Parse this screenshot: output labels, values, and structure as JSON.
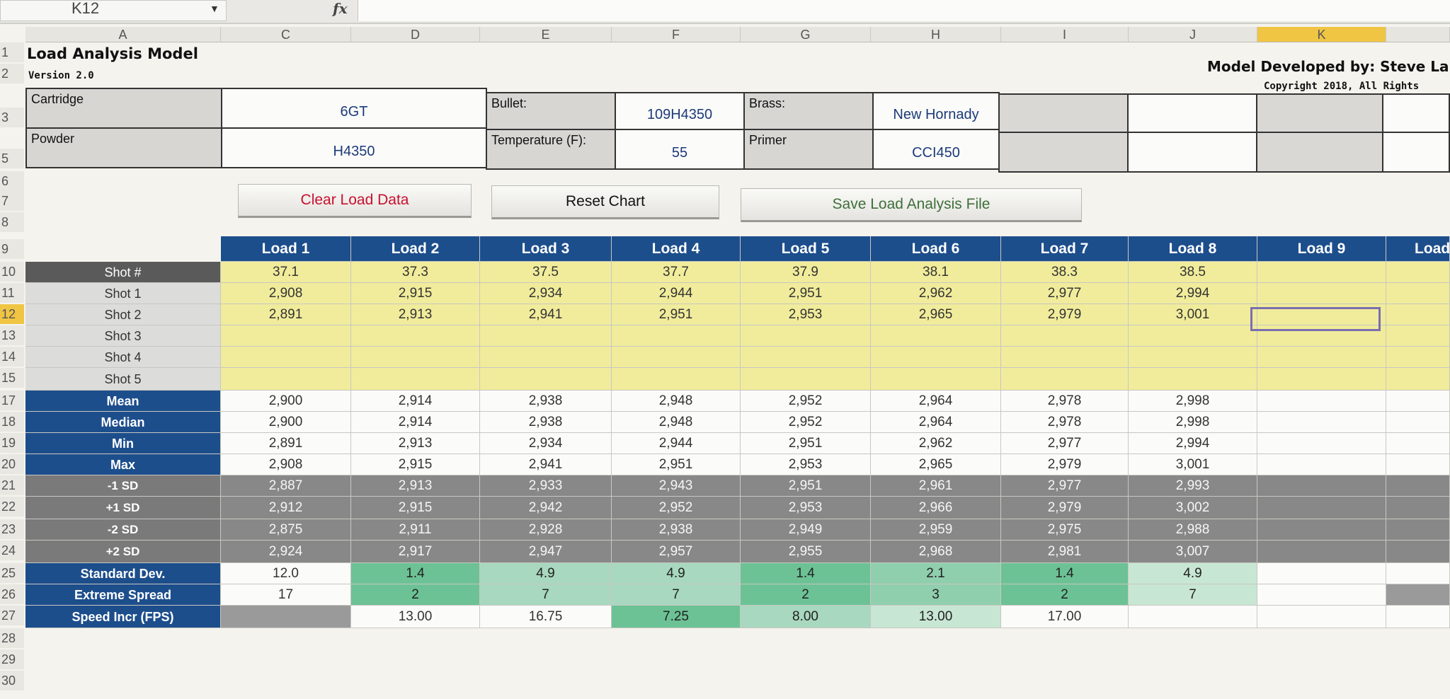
{
  "formula_bar": {
    "name_box": "K12",
    "fx": "fx"
  },
  "columns": [
    "A",
    "C",
    "D",
    "E",
    "F",
    "G",
    "H",
    "I",
    "J",
    "K"
  ],
  "rows": [
    "1",
    "2",
    "3",
    "5",
    "6",
    "7",
    "8",
    "9",
    "10",
    "11",
    "12",
    "13",
    "14",
    "15",
    "17",
    "18",
    "19",
    "20",
    "21",
    "22",
    "23",
    "24",
    "25",
    "26",
    "27",
    "28",
    "29",
    "30"
  ],
  "header": {
    "title": "Load Analysis Model",
    "version": "Version 2.0",
    "developer": "Model Developed by: Steve La",
    "copyright": "Copyright 2018, All Rights"
  },
  "info": {
    "cartridge_label": "Cartridge",
    "cartridge": "6GT",
    "bullet_label": "Bullet:",
    "bullet": "109H4350",
    "brass_label": "Brass:",
    "brass": "New Hornady",
    "powder_label": "Powder",
    "powder": "H4350",
    "temp_label": "Temperature (F):",
    "temp": "55",
    "primer_label": "Primer",
    "primer": "CCI450"
  },
  "buttons": {
    "clear": "Clear Load Data",
    "reset": "Reset Chart",
    "save": "Save Load Analysis File"
  },
  "colors": {
    "clear_button_text": "#c8102e",
    "save_button_text": "#3f6f3a",
    "load_header": "#1d4e8c",
    "input_yellow": "#f1ec9b"
  },
  "loads": [
    "Load 1",
    "Load 2",
    "Load 3",
    "Load 4",
    "Load 5",
    "Load 6",
    "Load 7",
    "Load 8",
    "Load 9",
    "Load"
  ],
  "row_labels": {
    "shot_num": "Shot #",
    "shots": [
      "Shot 1",
      "Shot 2",
      "Shot 3",
      "Shot 4",
      "Shot 5"
    ],
    "stats": [
      "Mean",
      "Median",
      "Min",
      "Max"
    ],
    "sd": [
      "-1 SD",
      "+1 SD",
      "-2 SD",
      "+2 SD"
    ],
    "summary": [
      "Standard Dev.",
      "Extreme Spread",
      "Speed Incr (FPS)"
    ]
  },
  "table": {
    "charge": [
      "37.1",
      "37.3",
      "37.5",
      "37.7",
      "37.9",
      "38.1",
      "38.3",
      "38.5"
    ],
    "shot1": [
      "2,908",
      "2,915",
      "2,934",
      "2,944",
      "2,951",
      "2,962",
      "2,977",
      "2,994"
    ],
    "shot2": [
      "2,891",
      "2,913",
      "2,941",
      "2,951",
      "2,953",
      "2,965",
      "2,979",
      "3,001"
    ],
    "mean": [
      "2,900",
      "2,914",
      "2,938",
      "2,948",
      "2,952",
      "2,964",
      "2,978",
      "2,998"
    ],
    "median": [
      "2,900",
      "2,914",
      "2,938",
      "2,948",
      "2,952",
      "2,964",
      "2,978",
      "2,998"
    ],
    "min": [
      "2,891",
      "2,913",
      "2,934",
      "2,944",
      "2,951",
      "2,962",
      "2,977",
      "2,994"
    ],
    "max": [
      "2,908",
      "2,915",
      "2,941",
      "2,951",
      "2,953",
      "2,965",
      "2,979",
      "3,001"
    ],
    "m1sd": [
      "2,887",
      "2,913",
      "2,933",
      "2,943",
      "2,951",
      "2,961",
      "2,977",
      "2,993"
    ],
    "p1sd": [
      "2,912",
      "2,915",
      "2,942",
      "2,952",
      "2,953",
      "2,966",
      "2,979",
      "3,002"
    ],
    "m2sd": [
      "2,875",
      "2,911",
      "2,928",
      "2,938",
      "2,949",
      "2,959",
      "2,975",
      "2,988"
    ],
    "p2sd": [
      "2,924",
      "2,917",
      "2,947",
      "2,957",
      "2,955",
      "2,968",
      "2,981",
      "3,007"
    ],
    "stdev": [
      "12.0",
      "1.4",
      "4.9",
      "4.9",
      "1.4",
      "2.1",
      "1.4",
      "4.9"
    ],
    "spread": [
      "17",
      "2",
      "7",
      "7",
      "2",
      "3",
      "2",
      "7"
    ],
    "speed": [
      "",
      "13.00",
      "16.75",
      "7.25",
      "8.00",
      "13.00",
      "17.00",
      ""
    ]
  }
}
